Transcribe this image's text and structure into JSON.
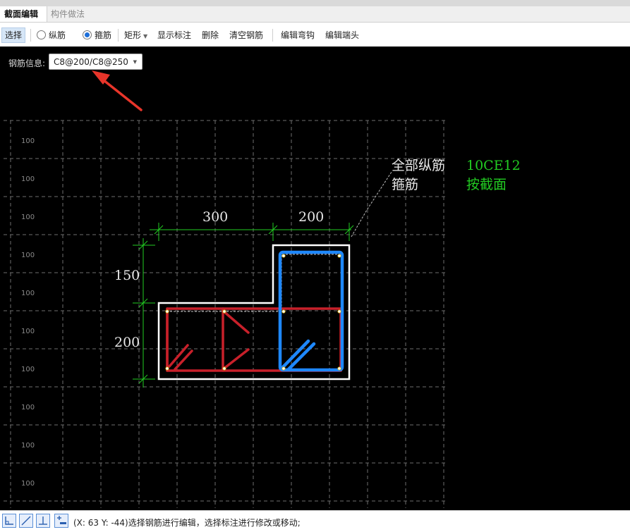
{
  "tabs": [
    {
      "label": "截面编辑",
      "active": true
    },
    {
      "label": "构件做法",
      "active": false
    }
  ],
  "toolbar": {
    "select_label": "选择",
    "radio_longitudinal": "纵筋",
    "radio_stirrup": "箍筋",
    "selected_radio": "箍筋",
    "shape_label": "矩形",
    "show_annotation": "显示标注",
    "delete": "删除",
    "clear_rebar": "清空钢筋",
    "edit_hook": "编辑弯钩",
    "edit_end": "编辑端头"
  },
  "rebar_info": {
    "label": "钢筋信息:",
    "value": "C8@200/C8@250"
  },
  "grid": {
    "tick_labels": [
      "100",
      "100",
      "100",
      "100",
      "100",
      "100",
      "100",
      "100",
      "100",
      "100"
    ]
  },
  "annotations": {
    "longitudinal_label": "全部纵筋",
    "longitudinal_value": "10CE12",
    "stirrup_label": "箍筋",
    "stirrup_value": "按截面"
  },
  "dimensions": {
    "top_left": "300",
    "top_right": "200",
    "left_top": "150",
    "left_bottom": "200"
  },
  "status": {
    "text": "(X: 63 Y: -44)选择钢筋进行编辑，选择标注进行修改或移动;"
  },
  "colors": {
    "canvas_bg": "#000000",
    "grid": "#6e6e6e",
    "outline": "#ffffff",
    "dimension": "#22cc22",
    "stirrup_red": "#c8202a",
    "stirrup_blue": "#1e88ff",
    "annotation_value": "#22cc22",
    "arrow": "#e8352a"
  }
}
